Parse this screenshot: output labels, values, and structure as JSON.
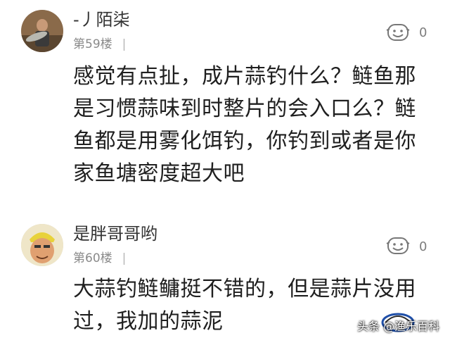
{
  "comments": [
    {
      "username": "-丿陌柒",
      "floor": "第59楼",
      "separator": "|",
      "likes": "0",
      "text": "感觉有点扯，成片蒜钓什么？鲢鱼那是习惯蒜味到时整片的会入口么？鲢鱼都是用雾化饵钓，你钓到或者是你家鱼塘密度超大吧",
      "avatar_icon": "fisherman-avatar-icon"
    },
    {
      "username": "是胖哥哥哟",
      "floor": "第60楼",
      "separator": "|",
      "likes": "0",
      "text": "大蒜钓鲢鳙挺不错的，但是蒜片没用过，我加的蒜泥",
      "avatar_icon": "cartoon-face-avatar-icon"
    }
  ],
  "like_icon": "thumbs-up-face-icon",
  "watermark": {
    "text": "头条 @渔乐百科",
    "logo_icon": "fishing-logo-icon"
  },
  "colors": {
    "background": "#ffffff",
    "username": "#333333",
    "meta": "#8a8a8a",
    "body_text": "#1f1f1f"
  }
}
